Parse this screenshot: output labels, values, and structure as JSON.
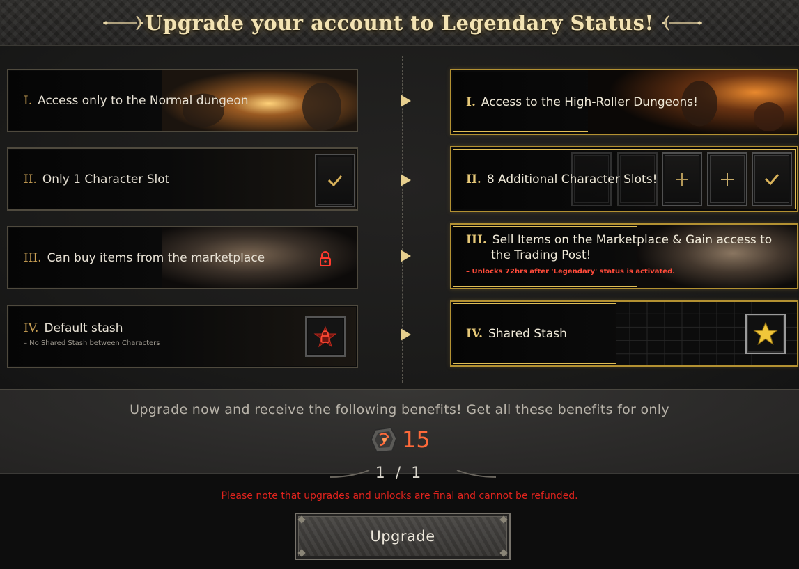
{
  "header": {
    "title": "Upgrade your account to Legendary Status!"
  },
  "current": [
    {
      "numeral": "I.",
      "text": "Access only to the Normal dungeon",
      "sub": ""
    },
    {
      "numeral": "II.",
      "text": "Only 1 Character Slot",
      "sub": ""
    },
    {
      "numeral": "III.",
      "text": "Can buy items from the marketplace",
      "sub": ""
    },
    {
      "numeral": "IV.",
      "text": "Default stash",
      "sub": "– No Shared Stash between Characters"
    }
  ],
  "legendary": [
    {
      "numeral": "I.",
      "text": "Access to the High-Roller Dungeons!",
      "sub": ""
    },
    {
      "numeral": "II.",
      "text": "8 Additional Character Slots!",
      "sub": ""
    },
    {
      "numeral": "III.",
      "text": "Sell Items on the Marketplace & Gain access to",
      "text2": "the Trading Post!",
      "sub": "– Unlocks 72hrs after 'Legendary' status is activated."
    },
    {
      "numeral": "IV.",
      "text": "Shared Stash",
      "sub": ""
    }
  ],
  "benefits_text": "Upgrade now and receive the following benefits! Get all these benefits for only",
  "price": {
    "value": "15",
    "currency_icon": "gem-currency-icon"
  },
  "pager": "1 / 1",
  "warning": "Please note that upgrades and unlocks are final and cannot be refunded.",
  "upgrade_button": "Upgrade",
  "colors": {
    "gold": "#e0bd55",
    "price": "#ff6a3a",
    "warning": "#e0231d",
    "roman_left": "#c9a055"
  }
}
